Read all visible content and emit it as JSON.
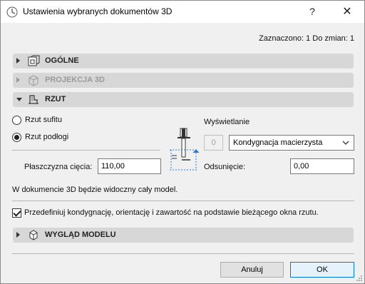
{
  "window": {
    "title": "Ustawienia wybranych dokumentów 3D",
    "help_label": "?",
    "close_label": "✕"
  },
  "selection_info": "Zaznaczono: 1 Do zmian: 1",
  "sections": {
    "general": {
      "label": "OGÓLNE",
      "icon": "document-3d-icon",
      "expanded": false
    },
    "projection": {
      "label": "PROJEKCJA 3D",
      "icon": "box-3d-icon",
      "expanded": false,
      "disabled": true
    },
    "plan": {
      "label": "RZUT",
      "icon": "floor-plan-icon",
      "expanded": true
    },
    "model_view": {
      "label": "WYGLĄD MODELU",
      "icon": "cube-icon",
      "expanded": false
    }
  },
  "plan": {
    "radio_ceiling": {
      "label": "Rzut sufitu",
      "checked": false
    },
    "radio_floor": {
      "label": "Rzut podłogi",
      "checked": true
    },
    "cut_plane_label": "Płaszczyzna cięcia:",
    "cut_plane_value": "110,00",
    "display_label": "Wyświetlanie",
    "display_number": "0",
    "display_select": "Kondygnacja macierzysta",
    "offset_label": "Odsunięcie:",
    "offset_value": "0,00",
    "info_text": "W dokumencie 3D będzie widoczny cały model.",
    "redefine_checkbox": {
      "label": "Przedefiniuj kondygnację, orientację i zawartość na podstawie bieżącego okna rzutu.",
      "checked": true
    }
  },
  "buttons": {
    "cancel": "Anuluj",
    "ok": "OK"
  },
  "colors": {
    "section_bar": "#d7d7d7",
    "dialog_bg": "#f0f0f0",
    "accent_blue": "#0078d7"
  }
}
